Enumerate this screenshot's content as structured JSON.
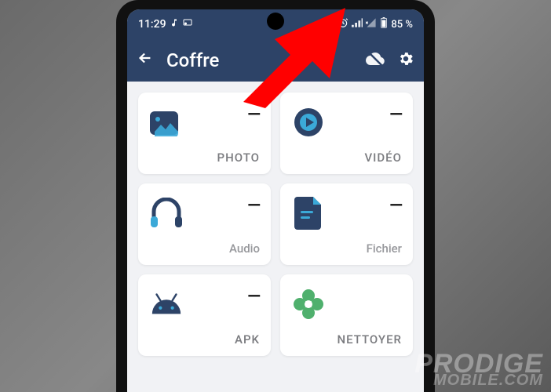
{
  "status": {
    "time": "11:29",
    "left_icons": [
      "music-note-icon",
      "cast-icon"
    ],
    "right_icons": [
      "alarm-icon",
      "signal-icon",
      "signal-x-icon",
      "battery-icon"
    ],
    "battery_text": "85 %"
  },
  "appbar": {
    "title": "Coffre",
    "back": "←",
    "actions": [
      "cloud-off-icon",
      "settings-icon"
    ]
  },
  "cards": [
    {
      "icon": "photo-icon",
      "count": "—",
      "label": "PHOTO"
    },
    {
      "icon": "video-icon",
      "count": "—",
      "label": "VIDÉO"
    },
    {
      "icon": "audio-icon",
      "count": "—",
      "label": "Audio"
    },
    {
      "icon": "file-icon",
      "count": "—",
      "label": "Fichier"
    },
    {
      "icon": "apk-icon",
      "count": "—",
      "label": "APK"
    },
    {
      "icon": "clean-icon",
      "count": "",
      "label": "NETTOYER"
    }
  ],
  "watermark": {
    "line1": "PRODIGE",
    "line2": "MOBILE.COM"
  }
}
